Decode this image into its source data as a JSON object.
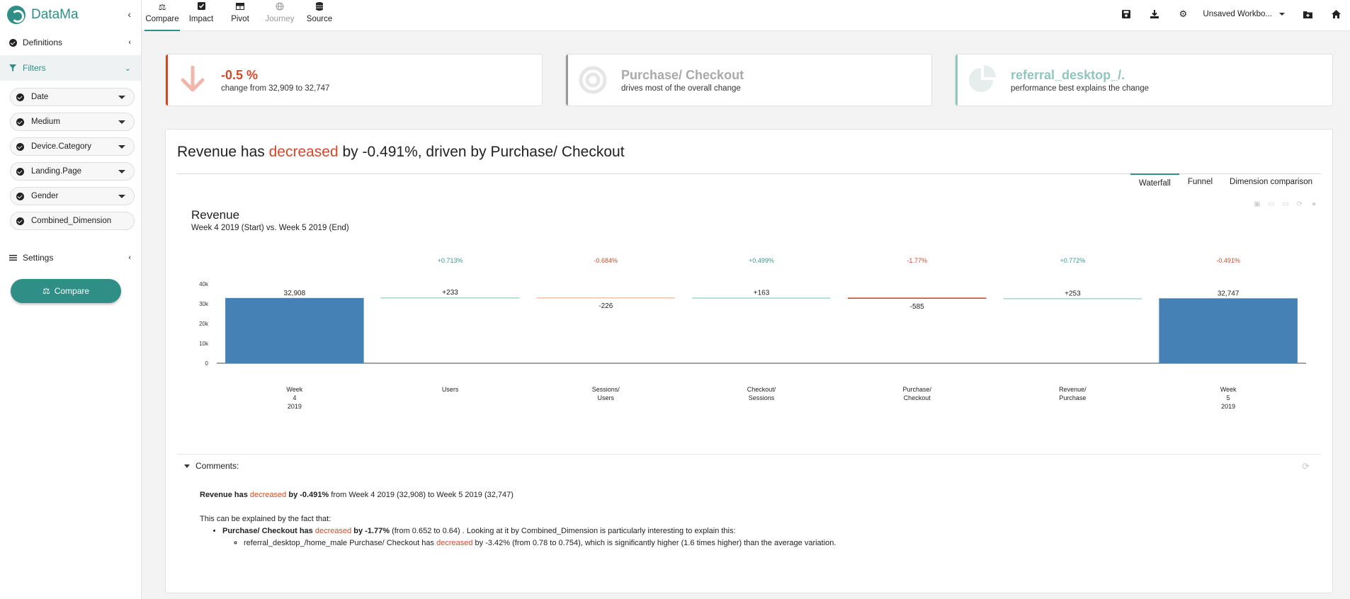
{
  "app": {
    "name": "DataMa",
    "colors": {
      "accent": "#2f8f86",
      "negative": "#d04a2a",
      "bar": "#4581b4"
    }
  },
  "sidebar": {
    "definitions_label": "Definitions",
    "filters_label": "Filters",
    "filters": [
      "Date",
      "Medium",
      "Device.Category",
      "Landing.Page",
      "Gender",
      "Combined_Dimension"
    ],
    "settings_label": "Settings",
    "compare_button": "Compare"
  },
  "topnav": {
    "tabs": [
      {
        "label": "Compare",
        "icon": "scale-icon"
      },
      {
        "label": "Impact",
        "icon": "checkbox-icon"
      },
      {
        "label": "Pivot",
        "icon": "table-icon"
      },
      {
        "label": "Journey",
        "icon": "globe-icon"
      },
      {
        "label": "Source",
        "icon": "database-icon"
      }
    ],
    "workbook": "Unsaved Workbo..."
  },
  "kpis": [
    {
      "title": "-0.5 %",
      "subtitle": "change from 32,909 to 32,747",
      "icon": "arrow-down-icon"
    },
    {
      "title": "Purchase/ Checkout",
      "subtitle": "drives most of the overall change",
      "icon": "target-icon"
    },
    {
      "title": "referral_desktop_/.",
      "subtitle": "performance best explains the change",
      "icon": "pie-icon"
    }
  ],
  "panel": {
    "headline_pre": "Revenue has ",
    "headline_word": "decreased",
    "headline_post": " by -0.491%, driven by Purchase/ Checkout",
    "view_tabs": [
      "Waterfall",
      "Funnel",
      "Dimension comparison"
    ]
  },
  "chart_data": {
    "type": "bar",
    "subtype": "waterfall",
    "title": "Revenue",
    "subtitle": "Week 4 2019 (Start) vs. Week 5 2019 (End)",
    "categories": [
      "Week 4 2019",
      "Users",
      "Sessions/ Users",
      "Checkout/ Sessions",
      "Purchase/ Checkout",
      "Revenue/ Purchase",
      "Week 5 2019"
    ],
    "values": [
      32908,
      233,
      -226,
      163,
      -585,
      253,
      32747
    ],
    "value_labels": [
      "32,908",
      "+233",
      "-226",
      "+163",
      "-585",
      "+253",
      "32,747"
    ],
    "pct_labels": [
      "",
      "+0.713%",
      "-0.684%",
      "+0.499%",
      "-1.77%",
      "+0.772%",
      "-0.491%"
    ],
    "ylim": [
      0,
      40000
    ],
    "yticks": [
      "0",
      "10k",
      "20k",
      "30k",
      "40k"
    ],
    "grid": false
  },
  "comments": {
    "label": "Comments:",
    "line1_pre": "Revenue has ",
    "line1_word": "decreased",
    "line1_bold": " by -0.491%",
    "line1_post": " from Week 4 2019 (32,908) to Week 5 2019 (32,747)",
    "line2": "This can be explained by the fact that:",
    "bullet_bold_pre": "Purchase/ Checkout has ",
    "bullet_word": "decreased",
    "bullet_bold_post": " by -1.77%",
    "bullet_rest": " (from 0.652 to 0.64) . Looking at it by Combined_Dimension is particularly interesting to explain this:",
    "sub_pre": "referral_desktop_/home_male Purchase/ Checkout has ",
    "sub_word": "decreased",
    "sub_post": " by -3.42% (from 0.78 to 0.754), which is significantly higher (1.6 times higher) than the average variation."
  }
}
